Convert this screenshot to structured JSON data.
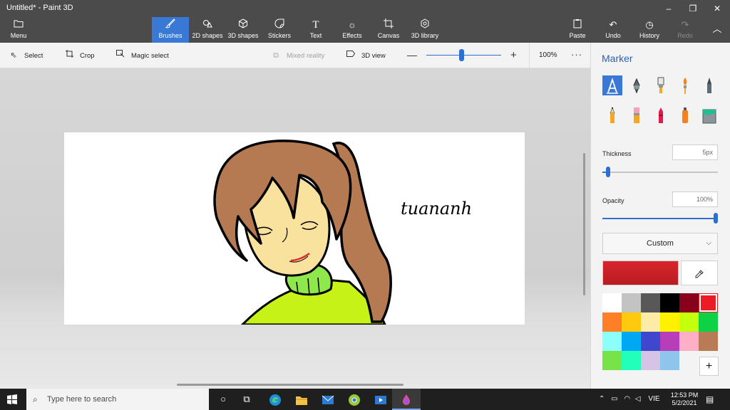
{
  "window": {
    "title": "Untitled* - Paint 3D",
    "minimize": "–",
    "maximize": "❐",
    "close": "✕"
  },
  "ribbon": {
    "menu": {
      "label": "Menu",
      "icon": "folder-icon"
    },
    "tabs": [
      {
        "label": "Brushes",
        "icon": "brush-icon",
        "active": true
      },
      {
        "label": "2D shapes",
        "icon": "2d-shapes-icon"
      },
      {
        "label": "3D shapes",
        "icon": "3d-shapes-icon"
      },
      {
        "label": "Stickers",
        "icon": "stickers-icon"
      },
      {
        "label": "Text",
        "icon": "text-icon"
      },
      {
        "label": "Effects",
        "icon": "effects-icon"
      },
      {
        "label": "Canvas",
        "icon": "canvas-icon"
      },
      {
        "label": "3D library",
        "icon": "3d-library-icon"
      }
    ],
    "paste": "Paste",
    "undo": "Undo",
    "history": "History",
    "redo": "Redo",
    "collapse": "︿"
  },
  "toolbar": {
    "select": "Select",
    "crop": "Crop",
    "magic_select": "Magic select",
    "mixed_reality": "Mixed reality",
    "view_3d": "3D view",
    "zoom_value": "100%",
    "zoom_level": 0.47,
    "more": "···"
  },
  "drawing": {
    "signature_text": "tuananh"
  },
  "panel": {
    "title": "Marker",
    "thickness_label": "Thickness",
    "thickness_value": "5px",
    "thickness_level": 0.05,
    "opacity_label": "Opacity",
    "opacity_value": "100%",
    "opacity_level": 1.0,
    "color_mode": "Custom",
    "current_color": "#d7262c",
    "brushes": [
      {
        "name": "marker",
        "selected": true
      },
      {
        "name": "calligraphy-pen"
      },
      {
        "name": "oil-brush"
      },
      {
        "name": "watercolor"
      },
      {
        "name": "pixel-pen"
      },
      {
        "name": "pencil"
      },
      {
        "name": "eraser"
      },
      {
        "name": "crayon"
      },
      {
        "name": "spray-can"
      },
      {
        "name": "fill"
      }
    ],
    "palette": [
      "#ffffff",
      "#c3c3c3",
      "#585858",
      "#000000",
      "#88001b",
      "#ec1c24",
      "#ff7f27",
      "#ffc90e",
      "#fdeca6",
      "#fff200",
      "#c4ff0e",
      "#0ed145",
      "#8cfffb",
      "#00a8f3",
      "#3f48cc",
      "#b83dba",
      "#ffaec8",
      "#b97a56",
      "#78e249",
      "#22ffba",
      "#d6c4e6",
      "#8fc4ed"
    ],
    "selected_swatch": 5,
    "add_color": "+"
  },
  "taskbar": {
    "search_placeholder": "Type here to search",
    "language": "VIE",
    "time": "12:53 PM",
    "date": "5/2/2021"
  }
}
